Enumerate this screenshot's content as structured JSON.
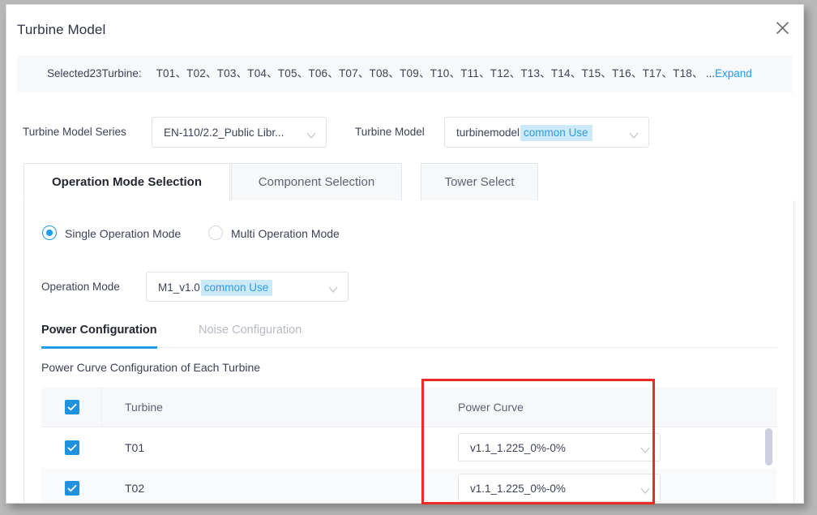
{
  "dialog": {
    "title": "Turbine Model",
    "close_icon": "close-icon"
  },
  "banner": {
    "label": "Selected23Turbine:",
    "turbines": "T01、T02、T03、T04、T05、T06、T07、T08、T09、T10、T11、T12、T13、T14、T15、T16、T17、T18、",
    "ellipsis": "...",
    "expand_label": "Expand"
  },
  "form": {
    "series_label": "Turbine Model Series",
    "series_value": "EN-110/2.2_Public Libr...",
    "model_label": "Turbine Model",
    "model_value": "turbinemodel",
    "model_tag": "common Use"
  },
  "tabs": [
    {
      "label": "Operation Mode Selection",
      "active": true
    },
    {
      "label": "Component Selection",
      "active": false
    },
    {
      "label": "Tower Select",
      "active": false
    }
  ],
  "panel": {
    "radios": [
      {
        "label": "Single Operation Mode",
        "selected": true
      },
      {
        "label": "Multi Operation Mode",
        "selected": false
      }
    ],
    "opmode_label": "Operation Mode",
    "opmode_value": "M1_v1.0",
    "opmode_tag": "common Use",
    "inner_tabs": [
      {
        "label": "Power Configuration",
        "active": true
      },
      {
        "label": "Noise Configuration",
        "active": false
      }
    ],
    "section_caption": "Power Curve Configuration of Each Turbine",
    "table": {
      "headers": {
        "turbine": "Turbine",
        "power_curve": "Power Curve"
      },
      "header_checked": true,
      "rows": [
        {
          "checked": true,
          "turbine": "T01",
          "power_curve": "v1.1_1.225_0%-0%"
        },
        {
          "checked": true,
          "turbine": "T02",
          "power_curve": "v1.1_1.225_0%-0%"
        }
      ]
    }
  },
  "colors": {
    "accent": "#1f9bf0",
    "checkbox": "#1f91dd",
    "tag_bg": "#cce9f7",
    "tag_text": "#2e9be0",
    "highlight_box": "#ee2a24",
    "text": "#3c4257",
    "muted": "#b5bac4"
  }
}
